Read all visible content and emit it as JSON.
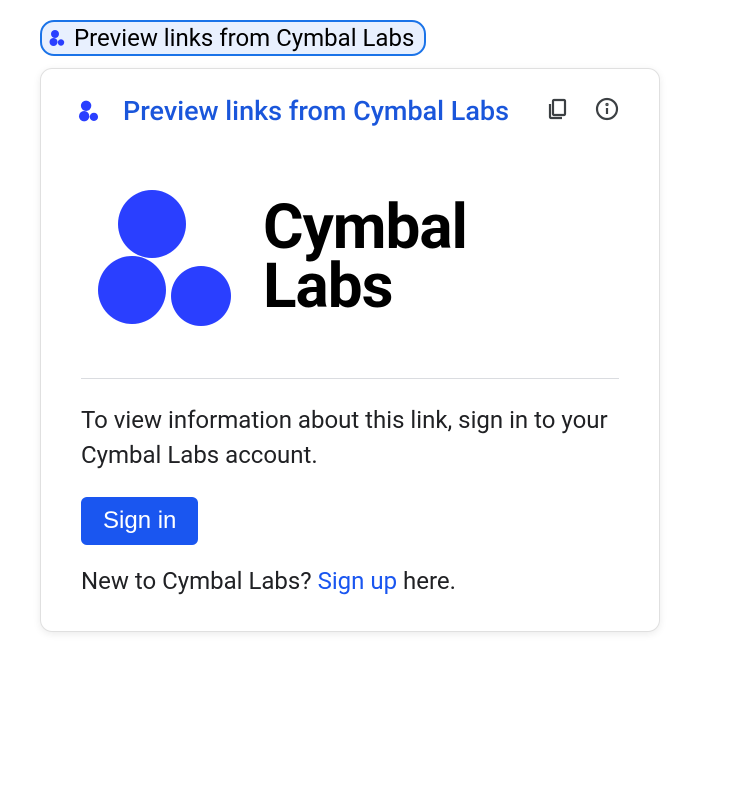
{
  "chip": {
    "label": "Preview links from Cymbal Labs"
  },
  "card": {
    "header": {
      "title": "Preview links from Cymbal Labs"
    },
    "logo": {
      "name_line1": "Cymbal",
      "name_line2": "Labs"
    },
    "description": "To view information about this link, sign in to your Cymbal Labs account.",
    "signin_button": "Sign in",
    "signup": {
      "prefix": "New to Cymbal Labs? ",
      "link": "Sign up",
      "suffix": " here."
    }
  },
  "colors": {
    "brand_blue": "#2a3fff",
    "link_blue": "#1a56f0"
  }
}
